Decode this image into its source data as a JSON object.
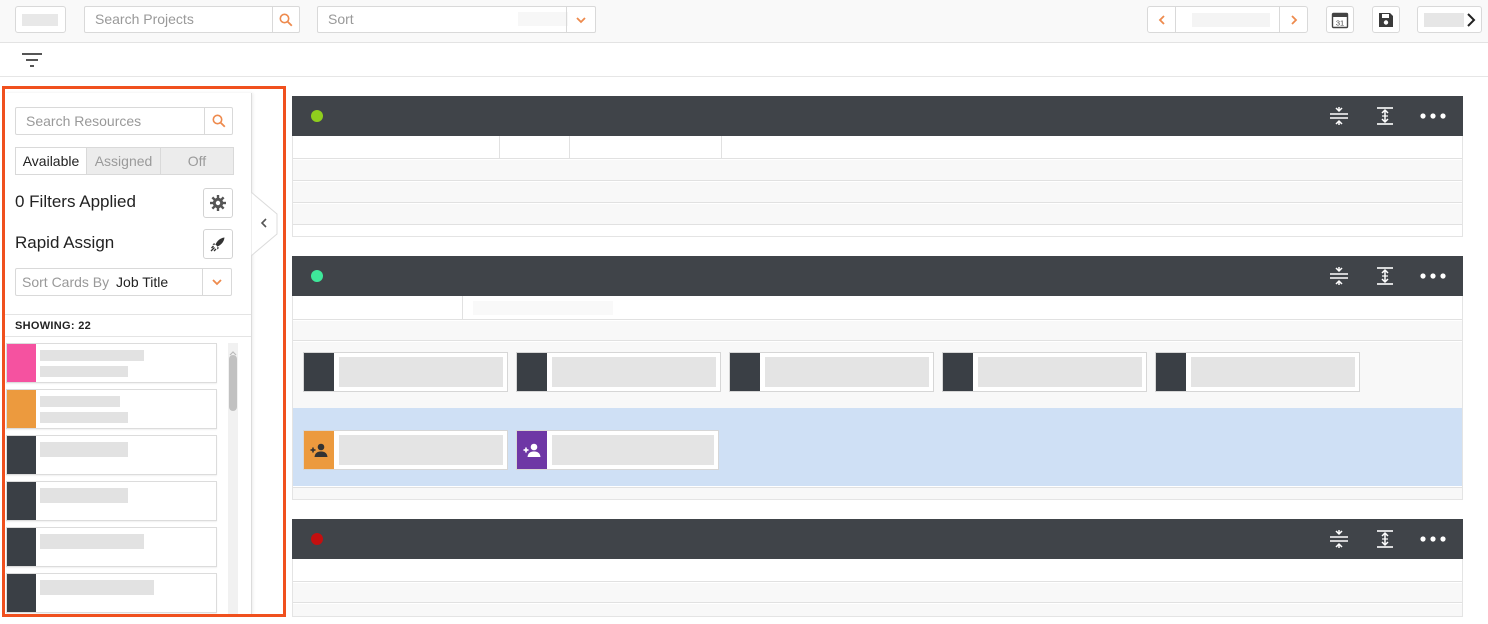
{
  "toolbar": {
    "search_projects_placeholder": "Search Projects",
    "sort_label": "Sort",
    "calendar_day": "31"
  },
  "sidebar": {
    "search_resources_placeholder": "Search Resources",
    "tabs": [
      {
        "label": "Available",
        "active": true
      },
      {
        "label": "Assigned",
        "active": false
      },
      {
        "label": "Off",
        "active": false
      }
    ],
    "filters_applied": "0 Filters Applied",
    "rapid_assign": "Rapid Assign",
    "sort_cards_by_label": "Sort Cards By",
    "sort_cards_by_value": "Job Title",
    "showing": "SHOWING: 22",
    "resource_swatches": [
      "#f552a0",
      "#ec9a3e",
      "#3a3f45",
      "#3a3f45",
      "#3a3f45",
      "#3a3f45"
    ]
  },
  "panels": [
    {
      "status_color": "#8fce1d"
    },
    {
      "status_color": "#3ee89a"
    },
    {
      "status_color": "#c40f0f"
    }
  ],
  "colors": {
    "accent": "#ee8a4d",
    "highlight_border": "#f0501e",
    "panel_header": "#404449",
    "assigned_row": "#cfe0f5",
    "orange_assignee": "#ec9a3e",
    "purple_assignee": "#6e37a5",
    "dark_card": "#3a3f45"
  }
}
